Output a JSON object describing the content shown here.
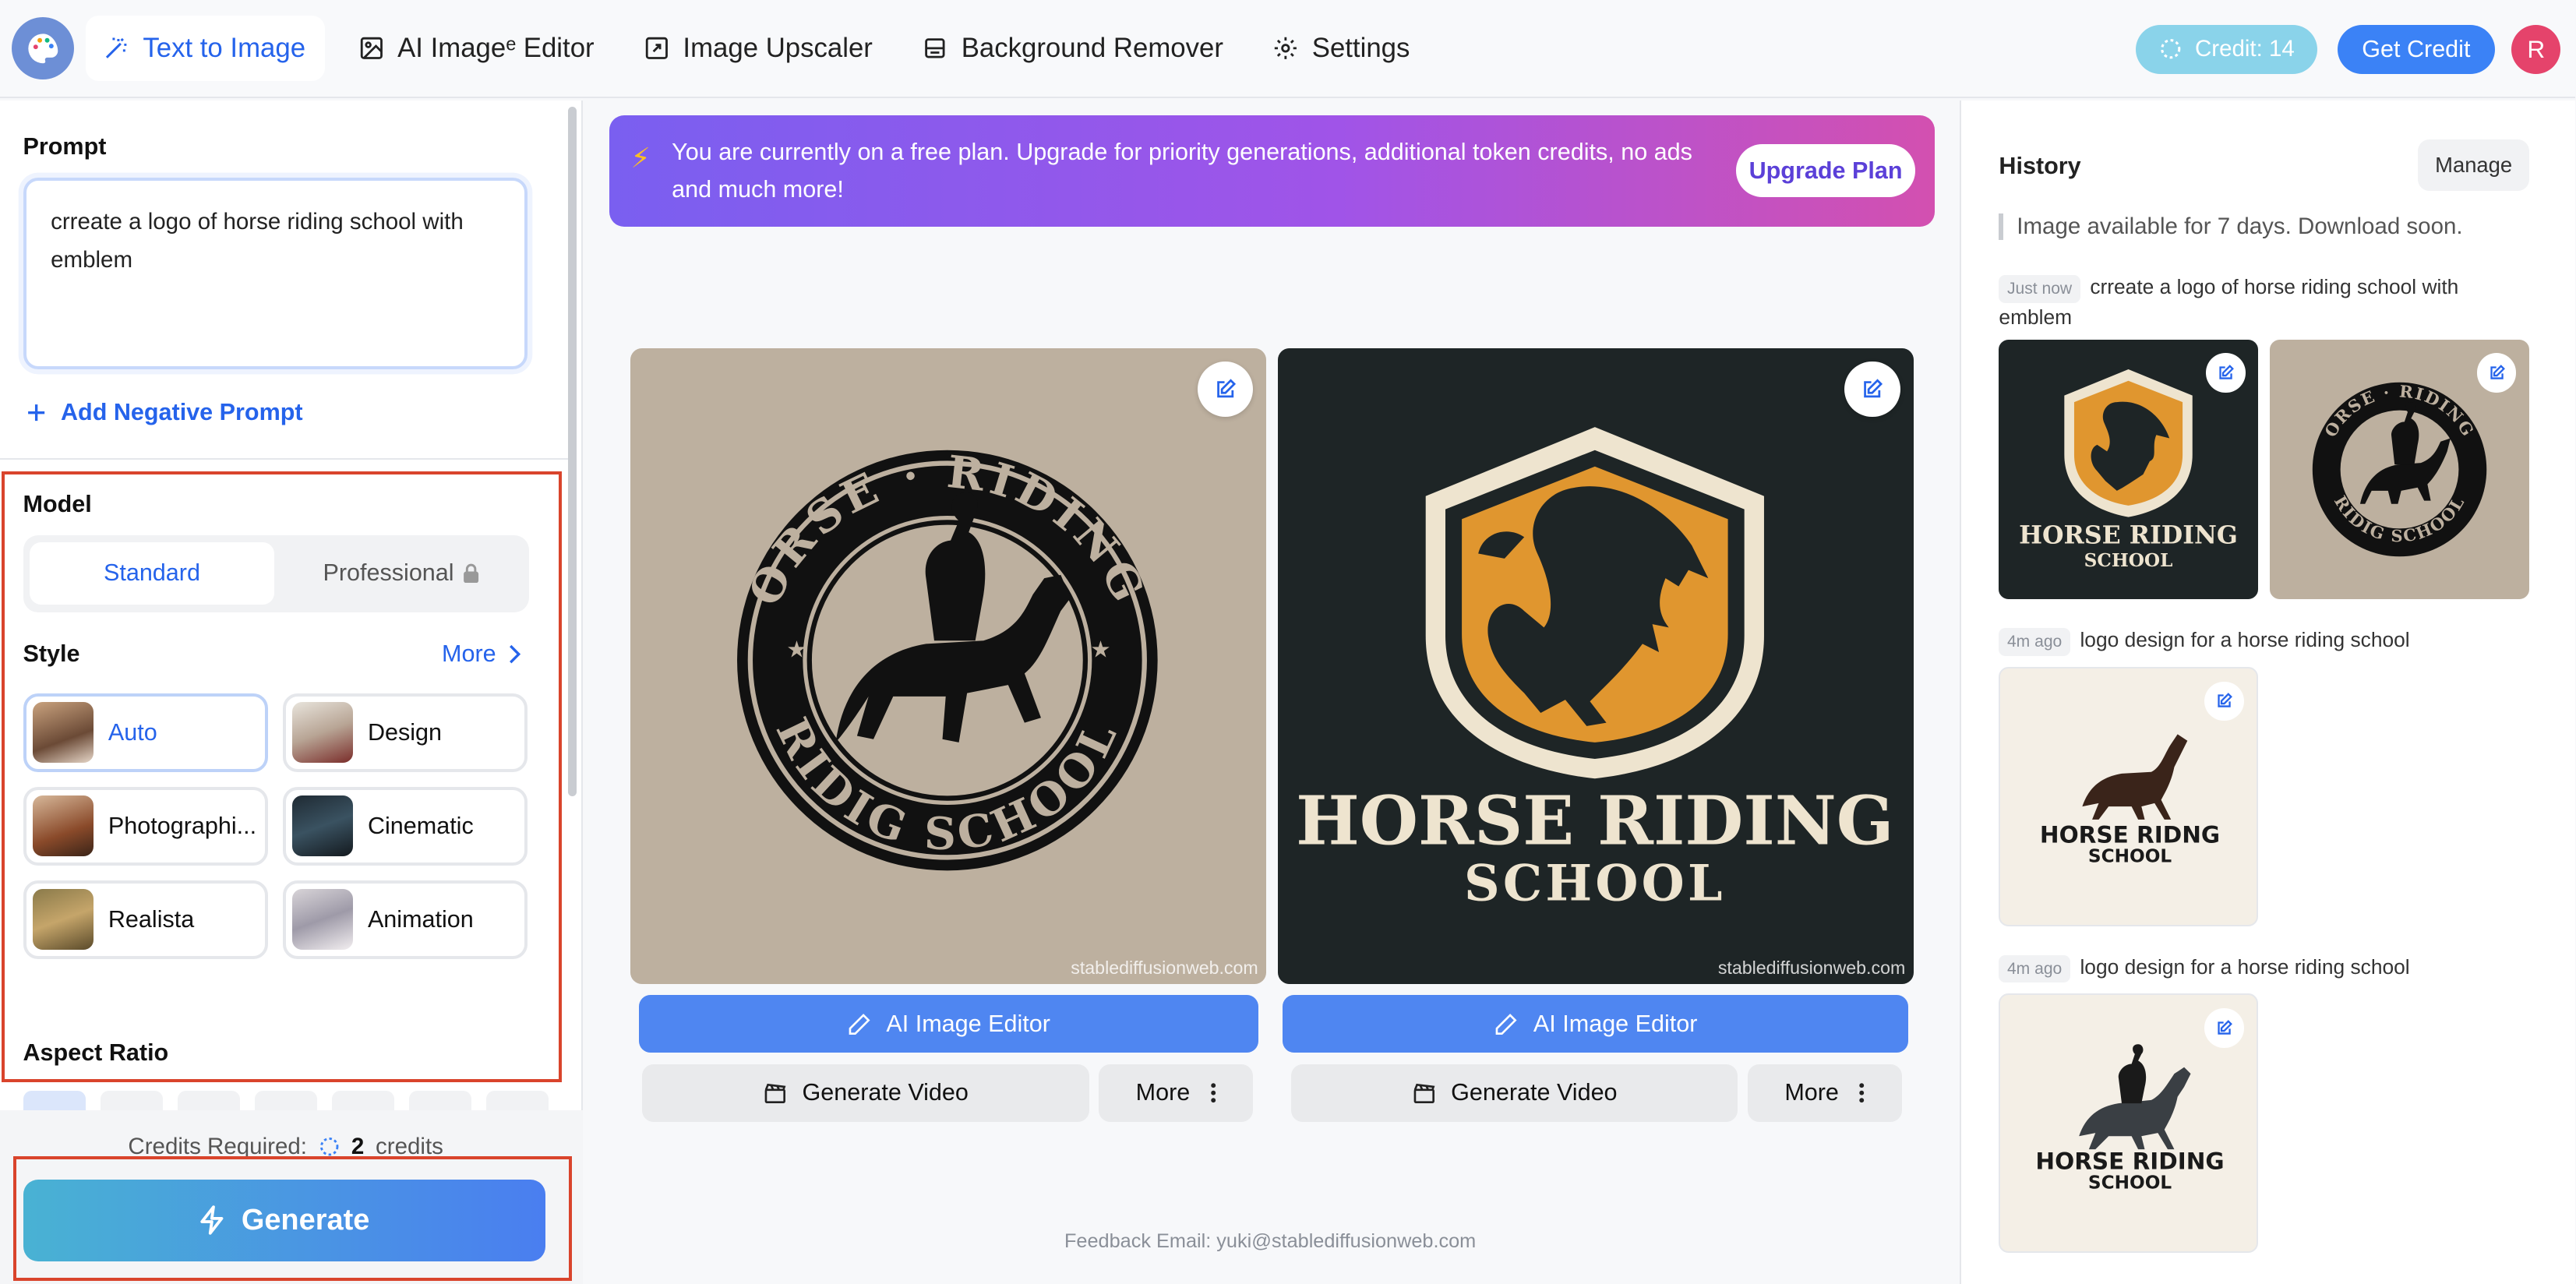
{
  "nav": {
    "items": [
      {
        "label": "Text to Image",
        "icon": "magic-wand-icon",
        "active": true
      },
      {
        "label": "AI Imageᵉ Editor",
        "icon": "image-icon",
        "active": false
      },
      {
        "label": "Image Upscaler",
        "icon": "resize-icon",
        "active": false
      },
      {
        "label": "Background Remover",
        "icon": "layers-icon",
        "active": false
      },
      {
        "label": "Settings",
        "icon": "gear-icon",
        "active": false
      }
    ],
    "credit": "Credit: 14",
    "get_credit": "Get Credit",
    "avatar_letter": "R"
  },
  "left": {
    "prompt_label": "Prompt",
    "prompt_text": "crreate a logo of horse riding school with emblem",
    "negative_prompt": "Add Negative Prompt",
    "model_label": "Model",
    "model_standard": "Standard",
    "model_professional": "Professional",
    "style_label": "Style",
    "style_more": "More",
    "styles": [
      {
        "label": "Auto",
        "selected": true
      },
      {
        "label": "Design",
        "selected": false
      },
      {
        "label": "Photographi...",
        "selected": false
      },
      {
        "label": "Cinematic",
        "selected": false
      },
      {
        "label": "Realista",
        "selected": false
      },
      {
        "label": "Animation",
        "selected": false
      }
    ],
    "aspect_label": "Aspect Ratio",
    "credits_required_label": "Credits Required:",
    "credits_count": "2",
    "credits_unit": "credits",
    "generate": "Generate"
  },
  "banner": {
    "text": "You are currently on a free plan. Upgrade for priority generations, additional token credits, no ads and much more!",
    "button": "Upgrade Plan"
  },
  "results": [
    {
      "watermark": "stablediffusionweb.com",
      "logo_text_top": "ORSE · RIDING",
      "logo_text_bottom": "RIDIG SCHOOL",
      "editor": "AI Image Editor",
      "video": "Generate Video",
      "more": "More"
    },
    {
      "watermark": "stablediffusionweb.com",
      "logo_title": "HORSE RIDING",
      "logo_sub": "SCHOOL",
      "editor": "AI Image Editor",
      "video": "Generate Video",
      "more": "More"
    }
  ],
  "feedback": "Feedback Email: yuki@stablediffusionweb.com",
  "history": {
    "title": "History",
    "manage": "Manage",
    "notice": "Image available for 7 days. Download soon.",
    "entries": [
      {
        "time": "Just now",
        "prompt": "crreate a logo of horse riding school with emblem"
      },
      {
        "time": "4m ago",
        "prompt": "logo design for a horse riding school"
      },
      {
        "time": "4m ago",
        "prompt": "logo design for a horse riding school"
      }
    ],
    "thumb1_title": "HORSE RIDING",
    "thumb1_sub": "SCHOOL",
    "thumb2_top": "ORSE · RIDING",
    "thumb2_bottom": "RIDIG SCHOOL",
    "thumb3_title": "HORSE RIDNG",
    "thumb3_sub": "SCHOOL",
    "thumb4_title": "HORSE RIDING",
    "thumb4_sub": "SCHOOL"
  },
  "colors": {
    "accent": "#2563eb",
    "highlight": "#d9442c",
    "gold": "#e0962f",
    "dark": "#1e2526",
    "beige": "#bdb09f"
  }
}
